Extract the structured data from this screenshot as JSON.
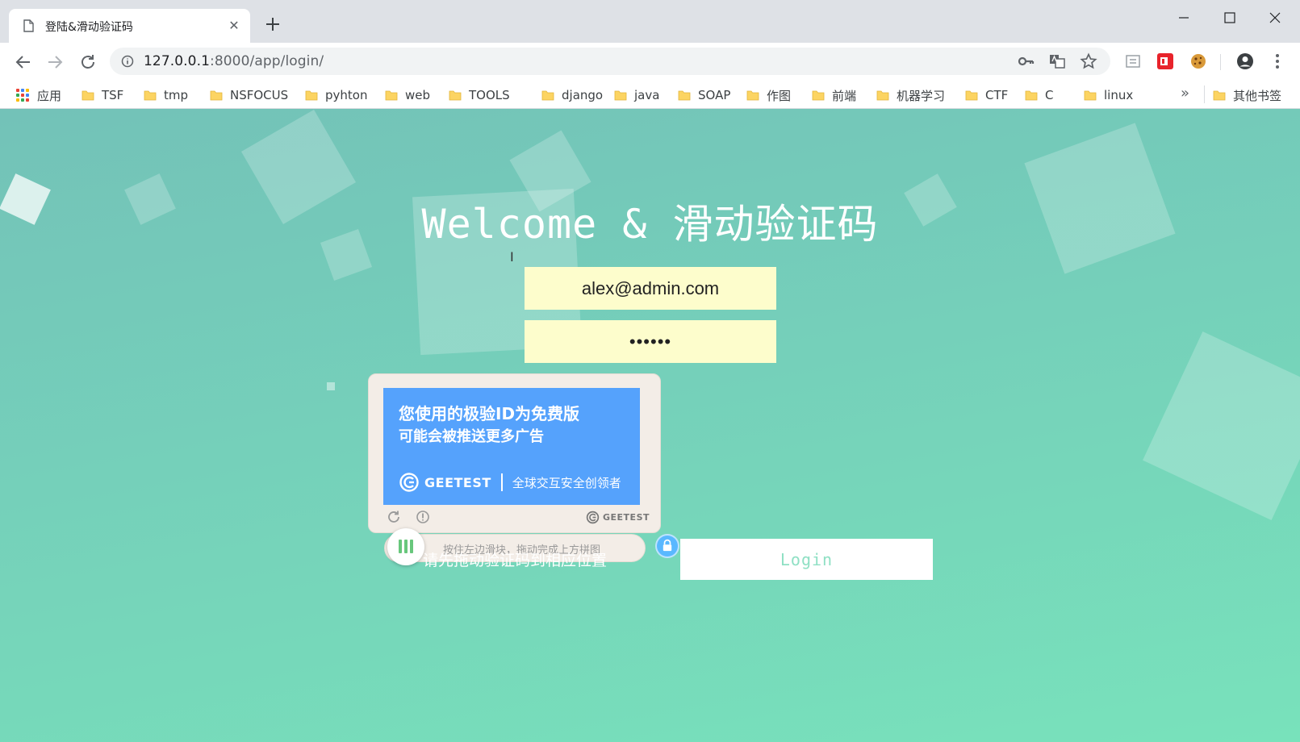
{
  "browser": {
    "tab_title": "登陆&滑动验证码",
    "url_host": "127.0.0.1",
    "url_rest": ":8000/app/login/",
    "icons": [
      "page-icon",
      "close-icon",
      "plus-icon",
      "back-icon",
      "forward-icon",
      "reload-icon",
      "info-icon",
      "key-icon",
      "translate-icon",
      "star-icon",
      "account-icon",
      "menu-icon"
    ]
  },
  "bookmarks": {
    "apps_label": "应用",
    "items": [
      "TSF",
      "tmp",
      "NSFOCUS",
      "pyhton",
      "web",
      "TOOLS",
      "django",
      "java",
      "SOAP",
      "作图",
      "前端",
      "机器学习",
      "CTF",
      "C",
      "linux"
    ],
    "more": "»",
    "other": "其他书签"
  },
  "page": {
    "heading_en": "Welcome &",
    "heading_cn": "滑动验证码",
    "email_value": "alex@admin.com",
    "password_value": "••••••",
    "login_label": "Login",
    "captcha_tip": "请先拖动验证码到相应位置"
  },
  "captcha": {
    "ad_line1": "您使用的极验ID为免费版",
    "ad_line2": "可能会被推送更多广告",
    "brand": "GEETEST",
    "slogan": "全球交互安全创领者",
    "footer_brand": "GEETEST",
    "slider_hint": "按住左边滑块，拖动完成上方拼图"
  },
  "colors": {
    "page_top": "#73c2b8",
    "page_bottom": "#78e2bb",
    "field_bg": "#fdfdcc",
    "captcha_blue": "#55a2fc",
    "login_text": "#8fe0c4"
  }
}
